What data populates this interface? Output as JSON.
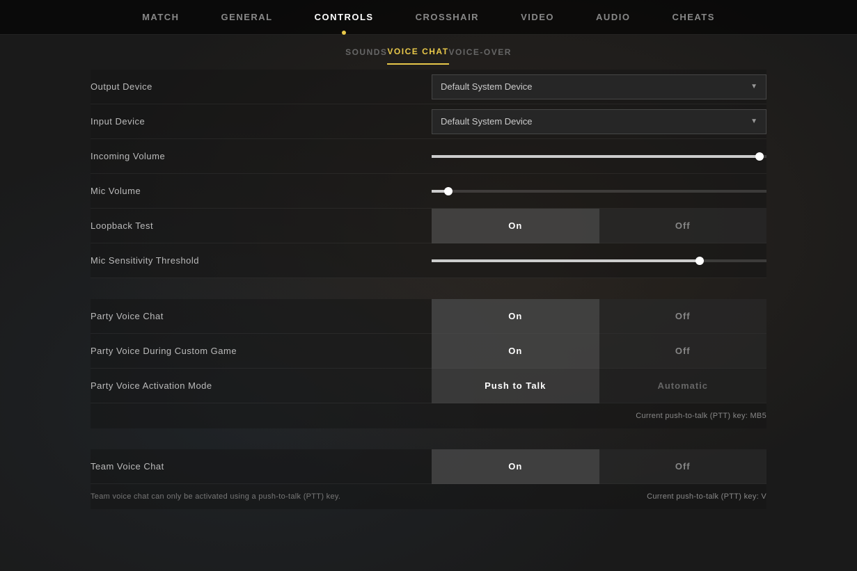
{
  "nav": {
    "items": [
      {
        "label": "MATCH",
        "active": false
      },
      {
        "label": "GENERAL",
        "active": false
      },
      {
        "label": "CONTROLS",
        "active": true
      },
      {
        "label": "CROSSHAIR",
        "active": false
      },
      {
        "label": "VIDEO",
        "active": false
      },
      {
        "label": "AUDIO",
        "active": false
      },
      {
        "label": "CHEATS",
        "active": false
      }
    ]
  },
  "subnav": {
    "items": [
      {
        "label": "SOUNDS",
        "active": false
      },
      {
        "label": "VOICE CHAT",
        "active": true
      },
      {
        "label": "VOICE-OVER",
        "active": false
      }
    ]
  },
  "settings": {
    "output_device_label": "Output Device",
    "output_device_value": "Default System Device",
    "input_device_label": "Input Device",
    "input_device_value": "Default System Device",
    "incoming_volume_label": "Incoming Volume",
    "incoming_volume_pct": 98,
    "mic_volume_label": "Mic Volume",
    "mic_volume_pct": 5,
    "loopback_label": "Loopback Test",
    "loopback_on": "On",
    "loopback_off": "Off",
    "mic_sens_label": "Mic Sensitivity Threshold",
    "mic_sens_pct": 80,
    "party_voice_label": "Party Voice Chat",
    "party_voice_on": "On",
    "party_voice_off": "Off",
    "party_custom_label": "Party Voice During Custom Game",
    "party_custom_on": "On",
    "party_custom_off": "Off",
    "party_activation_label": "Party Voice Activation Mode",
    "party_activation_ptt": "Push to Talk",
    "party_activation_auto": "Automatic",
    "party_ptt_note": "Current push-to-talk (PTT) key: MB5",
    "team_voice_label": "Team Voice Chat",
    "team_voice_on": "On",
    "team_voice_off": "Off",
    "team_note_left": "Team voice chat can only be activated using a push-to-talk (PTT) key.",
    "team_ptt_note": "Current push-to-talk (PTT) key: V"
  }
}
